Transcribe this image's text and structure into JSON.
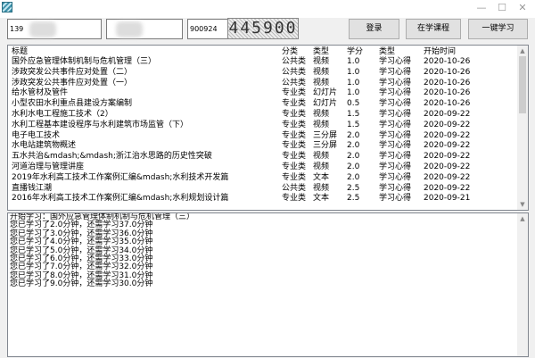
{
  "toolbar": {
    "account": "139",
    "password": "",
    "code_field": "900924",
    "captcha_text": "445900",
    "login_label": "登录",
    "courses_label": "在学课程",
    "one_click_label": "一键学习"
  },
  "list": {
    "columns": [
      "标题",
      "分类",
      "类型",
      "学分",
      "类型",
      "开始时间"
    ],
    "rows": [
      [
        "国外应急管理体制机制与危机管理（三）",
        "公共类",
        "视频",
        "1.0",
        "学习心得",
        "2020-10-26"
      ],
      [
        "涉政突发公共事件应对处置（二）",
        "公共类",
        "视频",
        "1.0",
        "学习心得",
        "2020-10-26"
      ],
      [
        "涉政突发公共事件应对处置（一）",
        "公共类",
        "视频",
        "1.0",
        "学习心得",
        "2020-10-26"
      ],
      [
        "给水管材及管件",
        "专业类",
        "幻灯片",
        "1.0",
        "学习心得",
        "2020-10-26"
      ],
      [
        "小型农田水利重点县建设方案编制",
        "专业类",
        "幻灯片",
        "0.5",
        "学习心得",
        "2020-10-26"
      ],
      [
        "水利水电工程施工技术（2）",
        "专业类",
        "视频",
        "1.5",
        "学习心得",
        "2020-09-22"
      ],
      [
        "水利工程基本建设程序与水利建筑市场监管（下）",
        "专业类",
        "视频",
        "1.5",
        "学习心得",
        "2020-09-22"
      ],
      [
        "电子电工技术",
        "专业类",
        "三分屏",
        "2.0",
        "学习心得",
        "2020-09-22"
      ],
      [
        "水电站建筑物概述",
        "专业类",
        "三分屏",
        "2.0",
        "学习心得",
        "2020-09-22"
      ],
      [
        "五水共治&mdash;&mdash;浙江治水思路的历史性突破",
        "专业类",
        "视频",
        "2.0",
        "学习心得",
        "2020-09-22"
      ],
      [
        "河道治理与管理讲座",
        "专业类",
        "视频",
        "2.0",
        "学习心得",
        "2020-09-22"
      ],
      [
        "2019年水利高工技术工作案例汇编&mdash;水利技术开发篇",
        "专业类",
        "文本",
        "2.0",
        "学习心得",
        "2020-09-22"
      ],
      [
        "直播钱江潮",
        "公共类",
        "视频",
        "2.5",
        "学习心得",
        "2020-09-22"
      ],
      [
        "2016年水利高工技术工作案例汇编&mdash;水利规划设计篇",
        "专业类",
        "文本",
        "2.5",
        "学习心得",
        "2020-09-21"
      ]
    ]
  },
  "log": {
    "lines": [
      "开始学习：国外应急管理体制机制与危机管理（三）",
      "您已学习了2.0分钟，还需学习37.0分钟",
      "您已学习了3.0分钟，还需学习36.0分钟",
      "您已学习了4.0分钟，还需学习35.0分钟",
      "您已学习了5.0分钟，还需学习34.0分钟",
      "您已学习了6.0分钟，还需学习33.0分钟",
      "您已学习了7.0分钟，还需学习32.0分钟",
      "您已学习了8.0分钟，还需学习31.0分钟",
      "您已学习了9.0分钟，还需学习30.0分钟"
    ]
  }
}
